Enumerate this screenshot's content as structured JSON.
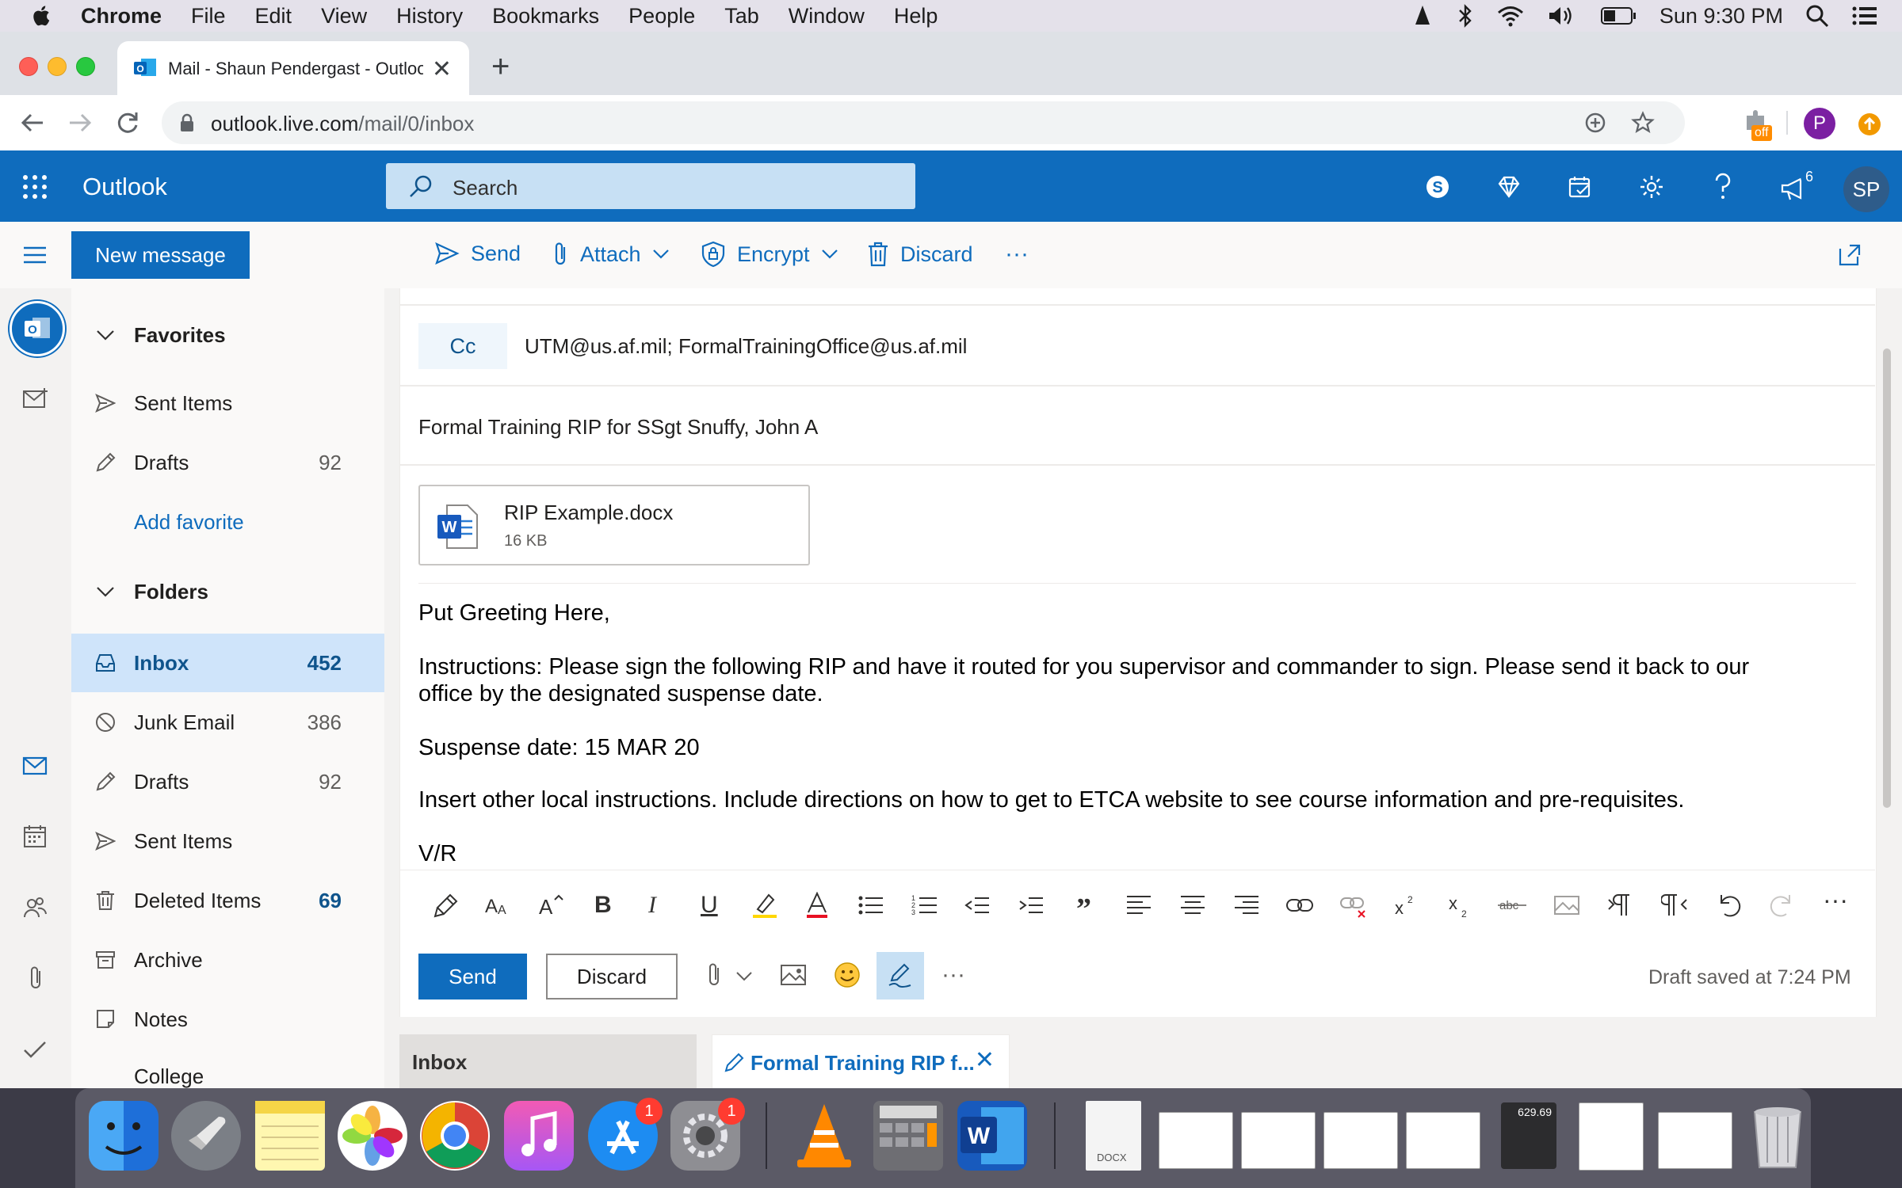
{
  "menubar": {
    "items": [
      "Chrome",
      "File",
      "Edit",
      "View",
      "History",
      "Bookmarks",
      "People",
      "Tab",
      "Window",
      "Help"
    ],
    "clock": "Sun 9:30 PM"
  },
  "browser": {
    "tab_title": "Mail - Shaun Pendergast - Outlook",
    "url_host": "outlook.live.com",
    "url_path": "/mail/0/inbox",
    "ext_badge": "off",
    "profile_initial": "P"
  },
  "outlook": {
    "brand": "Outlook",
    "search_placeholder": "Search",
    "notifications_count": "6",
    "avatar_initials": "SP"
  },
  "commands": {
    "new_message": "New message",
    "send": "Send",
    "attach": "Attach",
    "encrypt": "Encrypt",
    "discard": "Discard"
  },
  "folders": {
    "favorites_header": "Favorites",
    "fav_sent": "Sent Items",
    "fav_drafts": "Drafts",
    "fav_drafts_count": "92",
    "add_favorite": "Add favorite",
    "folders_header": "Folders",
    "inbox": "Inbox",
    "inbox_count": "452",
    "junk": "Junk Email",
    "junk_count": "386",
    "drafts": "Drafts",
    "drafts_count": "92",
    "sent": "Sent Items",
    "deleted": "Deleted Items",
    "deleted_count": "69",
    "archive": "Archive",
    "notes": "Notes",
    "college": "College"
  },
  "compose": {
    "cc_label": "Cc",
    "cc_value": "UTM@us.af.mil; FormalTrainingOffice@us.af.mil",
    "subject": "Formal Training RIP for SSgt Snuffy, John A",
    "attachment_name": "RIP Example.docx",
    "attachment_size": "16 KB",
    "body_greeting": "Put Greeting Here,",
    "body_instructions_1": "Instructions:  Please sign the following RIP and have it routed for you supervisor and commander to sign.  Please send it back to our",
    "body_instructions_2": "office by the designated suspense date.",
    "body_suspense": "Suspense date:  15 MAR 20",
    "body_local": "Insert other local instructions.  Include directions on how to get to ETCA website to see course information and pre-requisites.",
    "body_closing": "V/R",
    "send_button": "Send",
    "discard_button": "Discard",
    "draft_status": "Draft saved at 7:24 PM"
  },
  "bottom_tabs": {
    "inbox": "Inbox",
    "draft": "Formal Training RIP f..."
  },
  "dock": {
    "appstore_badge": "1",
    "prefs_badge": "1",
    "calc_display": "629.69",
    "docx_label": "DOCX"
  },
  "colors": {
    "accent": "#0f6cbd",
    "selected_folder": "#cfe4fa"
  }
}
